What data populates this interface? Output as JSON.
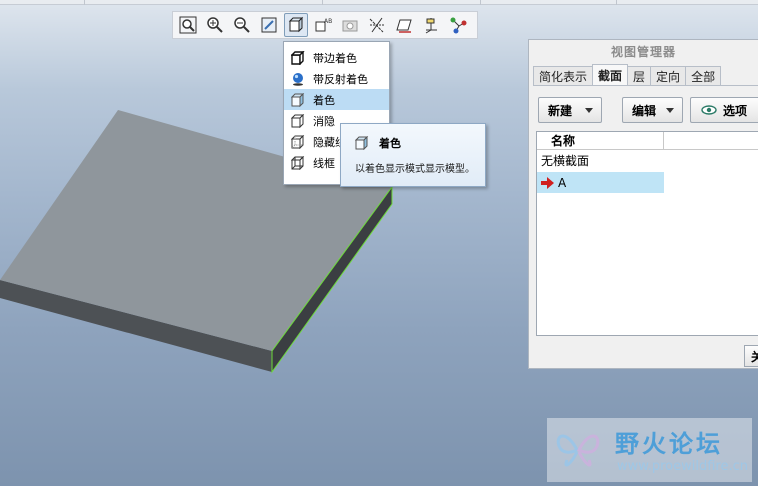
{
  "toolbar": {
    "buttons": [
      {
        "name": "zoom-fit",
        "icon": "zoom-fit-icon"
      },
      {
        "name": "zoom-in",
        "icon": "zoom-in-icon"
      },
      {
        "name": "zoom-out",
        "icon": "zoom-out-icon"
      },
      {
        "name": "refit",
        "icon": "refit-icon"
      },
      {
        "name": "display-style",
        "icon": "shaded-cube-icon",
        "active": true
      },
      {
        "name": "saved-views",
        "icon": "saved-views-icon"
      },
      {
        "name": "camera",
        "icon": "camera-icon"
      },
      {
        "name": "datum-axes",
        "icon": "datum-axes-icon"
      },
      {
        "name": "datum-planes",
        "icon": "datum-planes-icon"
      },
      {
        "name": "csys",
        "icon": "csys-icon"
      },
      {
        "name": "spin-center",
        "icon": "spin-center-icon"
      }
    ]
  },
  "display_menu": {
    "items": [
      {
        "label": "带边着色",
        "icon": "shaded-with-edges-icon"
      },
      {
        "label": "带反射着色",
        "icon": "reflection-shading-icon"
      },
      {
        "label": "着色",
        "icon": "shading-icon",
        "selected": true
      },
      {
        "label": "消隐",
        "icon": "no-hidden-icon"
      },
      {
        "label": "隐藏线",
        "icon": "hidden-line-icon"
      },
      {
        "label": "线框",
        "icon": "wireframe-icon"
      }
    ]
  },
  "tooltip": {
    "title": "着色",
    "description": "以着色显示模式显示模型。"
  },
  "view_manager": {
    "title": "视图管理器",
    "tabs": [
      {
        "label": "简化表示"
      },
      {
        "label": "截面",
        "active": true
      },
      {
        "label": "层"
      },
      {
        "label": "定向"
      },
      {
        "label": "全部"
      }
    ],
    "new_label": "新建",
    "edit_label": "编辑",
    "options_label": "选项",
    "column_name": "名称",
    "rows": [
      {
        "label": "无横截面"
      },
      {
        "label": "A",
        "selected": true
      }
    ],
    "close_label": "关"
  },
  "watermark": {
    "title": "野火论坛",
    "url": "www.proewildfire.cn"
  },
  "colors": {
    "selection": "#bcdcf4",
    "model_top": "#8f969c",
    "model_edge": "#6ddc3a"
  }
}
